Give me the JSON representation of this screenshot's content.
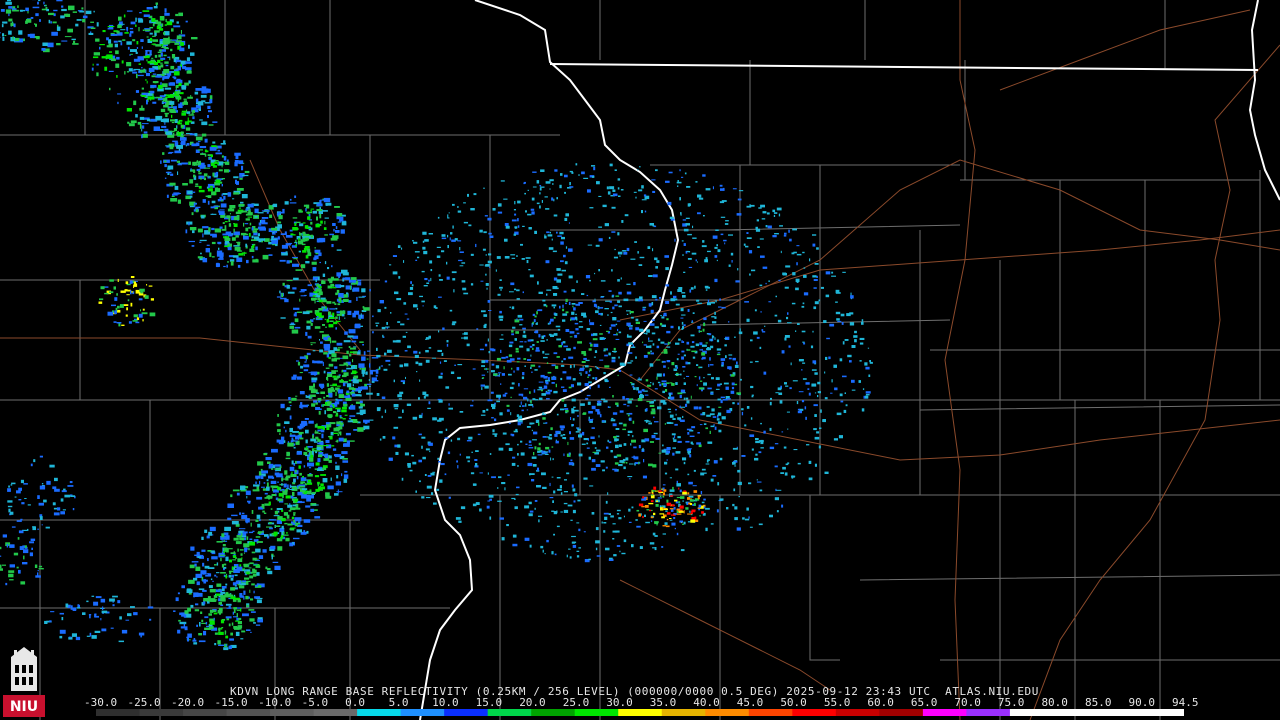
{
  "product": {
    "station": "KDVN",
    "name": "LONG RANGE BASE REFLECTIVITY",
    "resolution": "(0.25KM / 256 LEVEL)",
    "code": "(000000/0000 0.5 DEG)",
    "timestamp": "2025-09-12 23:43 UTC",
    "source": "ATLAS.NIU.EDU"
  },
  "scale": {
    "labels": [
      "-30.0",
      "-25.0",
      "-20.0",
      "-15.0",
      "-10.0",
      "-5.0",
      "0.0",
      "5.0",
      "10.0",
      "15.0",
      "20.0",
      "25.0",
      "30.0",
      "35.0",
      "40.0",
      "45.0",
      "50.0",
      "55.0",
      "60.0",
      "65.0",
      "70.0",
      "75.0",
      "80.0",
      "85.0",
      "90.0",
      "94.5"
    ],
    "colors": [
      "#2f2f2f",
      "#3a3a3a",
      "#464646",
      "#525252",
      "#5e5e5e",
      "#6a6a6a",
      "#06d9e9",
      "#1e90ff",
      "#0a2fff",
      "#00d64a",
      "#00a300",
      "#00e600",
      "#ffff00",
      "#e6b400",
      "#ff8c00",
      "#ff4500",
      "#ff0000",
      "#c80000",
      "#a00000",
      "#ff00ff",
      "#9b30ff",
      "#ffffff",
      "#ffffff",
      "#ffffff",
      "#ffffff",
      "#ffffff"
    ]
  },
  "logo": {
    "text": "NIU",
    "colors": {
      "tower": "#e8e8e8",
      "banner": "#c8102e"
    }
  },
  "map_colors": {
    "background": "#000000",
    "county_lines": "#6e6e6e",
    "state_lines": "#ffffff",
    "highways": "#8b4a2b",
    "reflectivity_low": "#1fb6d8",
    "reflectivity_mid": "#1a6bff",
    "reflectivity_high": "#22c84a"
  }
}
